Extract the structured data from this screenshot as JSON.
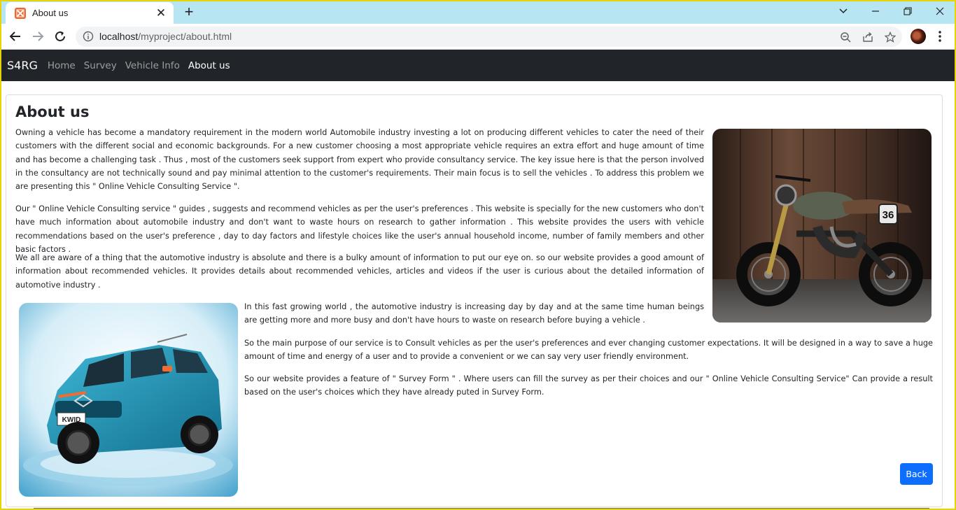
{
  "browser": {
    "tab_title": "About us",
    "tab_close_glyph": "✕",
    "new_tab_glyph": "+",
    "url_host": "localhost",
    "url_path": "/myproject/about.html",
    "accent_tabstrip": "#b7e6f2"
  },
  "nav": {
    "brand": "S4RG",
    "links": [
      "Home",
      "Survey",
      "Vehicle Info",
      "About us"
    ],
    "active_index": 3,
    "background": "#212529"
  },
  "content": {
    "heading": "About us",
    "paragraphs": [
      "Owning a vehicle has become a mandatory requirement in the modern world Automobile industry investing a lot on producing different vehicles to cater the need of their customers with the different social and economic backgrounds. For a new customer choosing a most appropriate vehicle requires an extra effort and huge amount of time and has become a challenging task . Thus , most of the customers seek support from expert who provide consultancy service. The key issue here is that the person involved in the consultancy are not technically sound and pay minimal attention to the customer's requirements. Their main focus is to sell the vehicles . To address this problem we are presenting this \" Online Vehicle Consulting Service \".",
      "Our \" Online Vehicle Consulting service \" guides , suggests and recommend vehicles as per the user's preferences . This website is specially for the new customers who don't have much information about automobile industry and don't want to waste hours on research to gather information . This website provides the users with vehicle recommendations based on the user's preference , day to day factors and lifestyle choices like the user's annual household income, number of family members and other basic factors .",
      "We all are aware of a thing that the automotive industry is absolute and there is a bulky amount of information to put our eye on. so our website provides a good amount of information about recommended vehicles. It provides details about recommended vehicles, articles and videos if the user is curious about the detailed information of automotive industry .",
      "In this fast growing world , the automotive industry is increasing day by day and at the same time human beings are getting more and more busy and don't have hours to waste on research before buying a vehicle .",
      "So the main purpose of our service is to Consult vehicles as per the user's preferences and ever changing customer expectations. It will be designed in a way to save a huge amount of time and energy of a user and to provide a convenient or we can say very user friendly environment.",
      "So our website provides a feature of \" Survey Form \" . Where users can fill the survey as per their choices and our \" Online Vehicle Consulting Service\" Can provide a result based on the user's choices which they have already puted in Survey Form."
    ],
    "car_plate": "KWID",
    "bike_number": "36",
    "back_label": "Back",
    "back_color": "#0d6efd"
  }
}
